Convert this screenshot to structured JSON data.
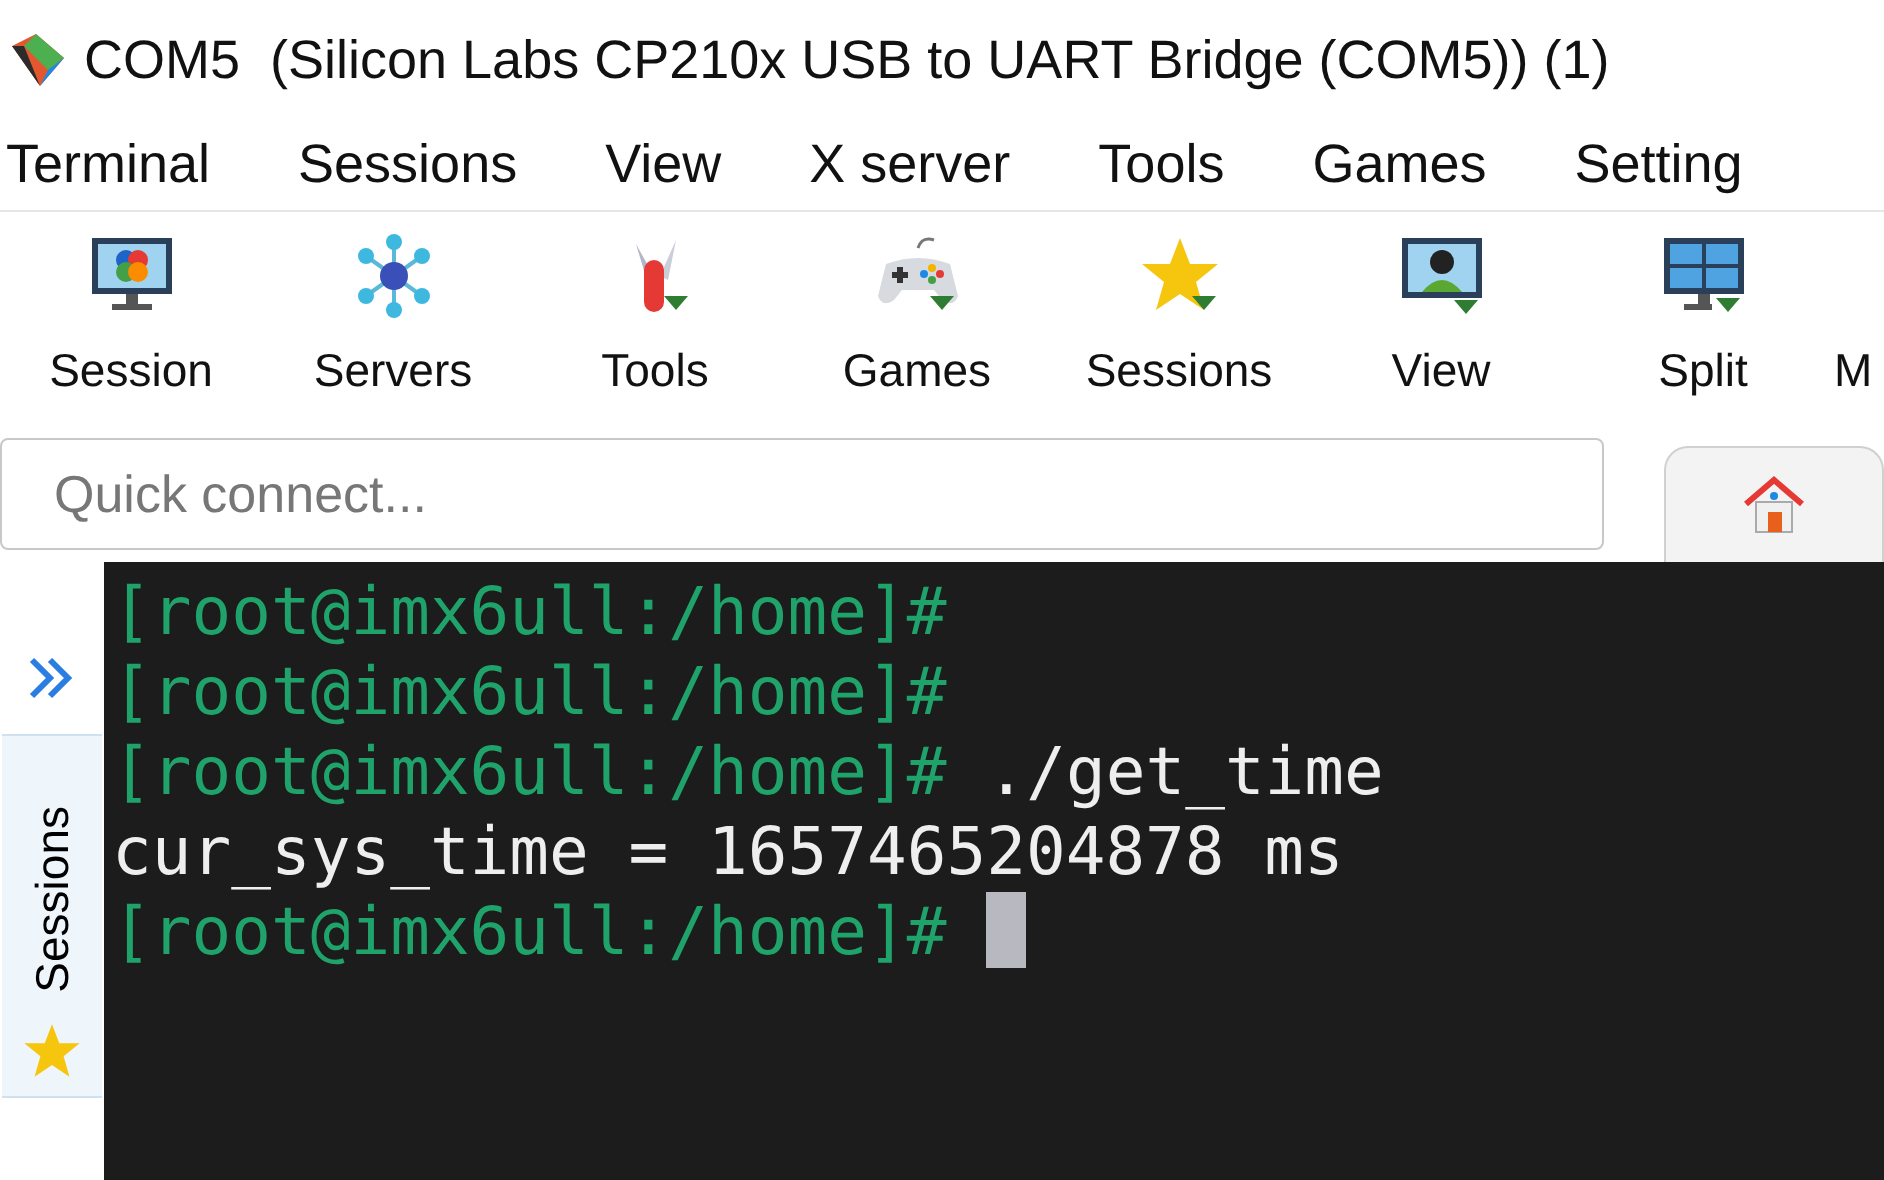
{
  "window": {
    "title": "COM5  (Silicon Labs CP210x USB to UART Bridge (COM5)) (1)"
  },
  "menu": [
    "Terminal",
    "Sessions",
    "View",
    "X server",
    "Tools",
    "Games",
    "Setting"
  ],
  "toolbar": [
    {
      "label": "Session",
      "kind": "monitor"
    },
    {
      "label": "Servers",
      "kind": "network"
    },
    {
      "label": "Tools",
      "kind": "knife"
    },
    {
      "label": "Games",
      "kind": "gamepad"
    },
    {
      "label": "Sessions",
      "kind": "star"
    },
    {
      "label": "View",
      "kind": "person"
    },
    {
      "label": "Split",
      "kind": "split"
    },
    {
      "label": "M",
      "kind": "none"
    }
  ],
  "quick_connect": {
    "placeholder": "Quick connect..."
  },
  "sidebar": {
    "tab": "Sessions"
  },
  "terminal": {
    "lines": [
      {
        "kind": "prompt",
        "prompt": "[root@imx6ull:/home]#",
        "cursor": false
      },
      {
        "kind": "prompt",
        "prompt": "[root@imx6ull:/home]#",
        "cursor": false
      },
      {
        "kind": "prompt",
        "prompt": "[root@imx6ull:/home]#",
        "command": "./get_time",
        "cursor": false
      },
      {
        "kind": "output",
        "text": "cur_sys_time = 1657465204878 ms"
      },
      {
        "kind": "prompt",
        "prompt": "[root@imx6ull:/home]#",
        "cursor": true
      }
    ]
  }
}
